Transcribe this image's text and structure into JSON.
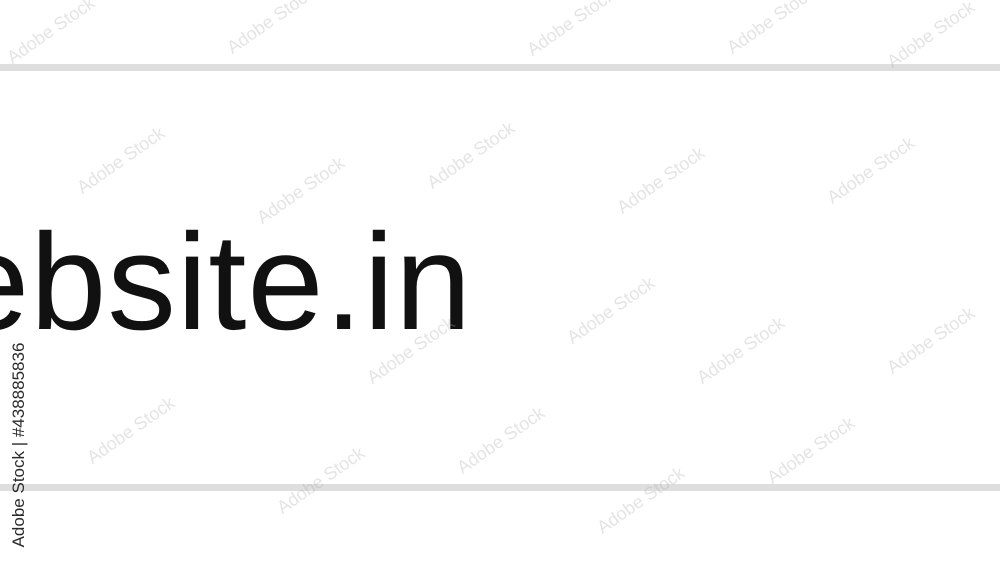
{
  "address_bar": {
    "url_text": "ebsite.in"
  },
  "watermark": {
    "pattern_text": "Adobe Stock",
    "id_text": "Adobe Stock | #438885836"
  },
  "colors": {
    "background": "#ffffff",
    "bar_border": "#dedede",
    "text": "#111111"
  }
}
